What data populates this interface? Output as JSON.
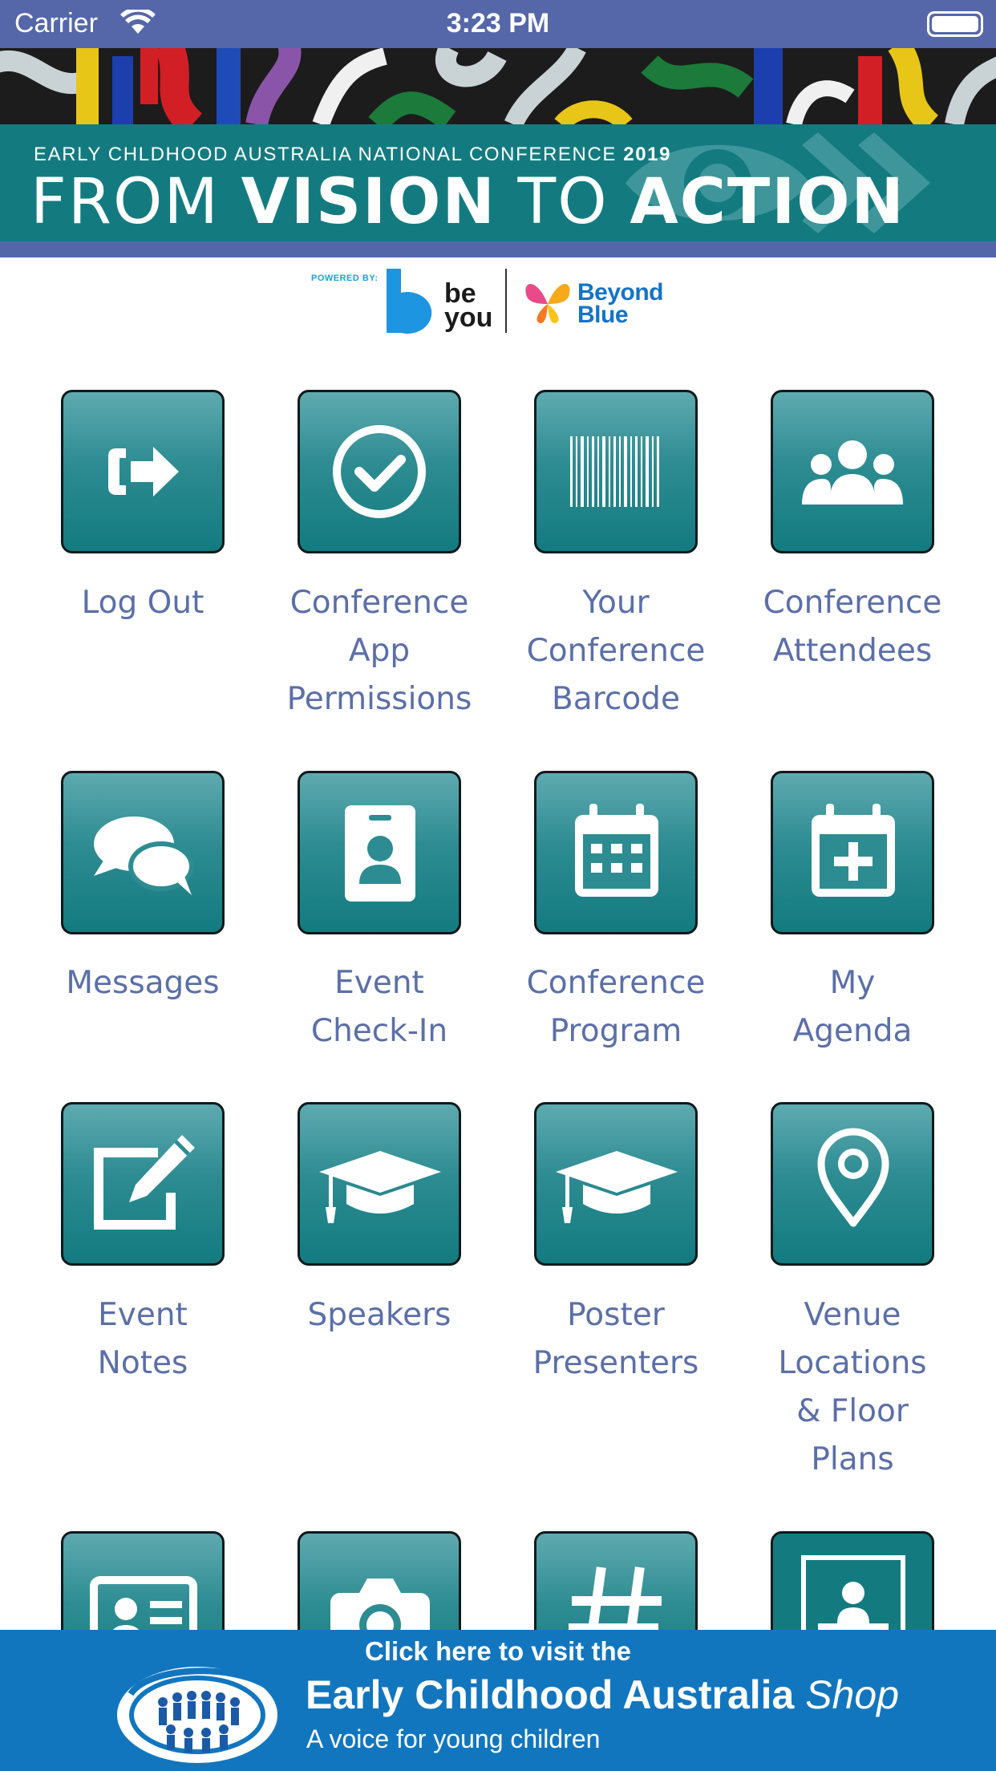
{
  "status_bar": {
    "carrier": "Carrier",
    "time": "3:23 PM",
    "icons": [
      "wifi-icon",
      "battery-icon"
    ]
  },
  "banner": {
    "subtitle_prefix": "EARLY CHLDHOOD AUSTRALIA NATIONAL CONFERENCE",
    "subtitle_year": "2019",
    "headline": {
      "part1": "FROM",
      "part2": "VISION",
      "part3": "TO",
      "part4": "ACTION"
    },
    "colors": {
      "teal": "#137b80",
      "stripe": "#5466aa"
    }
  },
  "sponsor": {
    "powered_by": "POWERED BY:",
    "beyou_line1": "be",
    "beyou_line2": "you",
    "beyondblue_line1": "Beyond",
    "beyondblue_line2": "Blue"
  },
  "menu": {
    "tiles": [
      {
        "icon": "logout-icon",
        "lines": [
          "Log Out"
        ]
      },
      {
        "icon": "check-circle-icon",
        "lines": [
          "Conference",
          "App",
          "Permissions"
        ]
      },
      {
        "icon": "barcode-icon",
        "lines": [
          "Your",
          "Conference",
          "Barcode"
        ]
      },
      {
        "icon": "users-icon",
        "lines": [
          "Conference",
          "Attendees"
        ]
      },
      {
        "icon": "chat-bubbles-icon",
        "lines": [
          "Messages"
        ]
      },
      {
        "icon": "id-badge-icon",
        "lines": [
          "Event",
          "Check-In"
        ]
      },
      {
        "icon": "calendar-icon",
        "lines": [
          "Conference",
          "Program"
        ]
      },
      {
        "icon": "calendar-plus-icon",
        "lines": [
          "My",
          "Agenda"
        ]
      },
      {
        "icon": "edit-note-icon",
        "lines": [
          "Event",
          "Notes"
        ]
      },
      {
        "icon": "graduation-cap-icon",
        "lines": [
          "Speakers"
        ]
      },
      {
        "icon": "graduation-cap-icon",
        "lines": [
          "Poster",
          "Presenters"
        ]
      },
      {
        "icon": "map-pin-icon",
        "lines": [
          "Venue",
          "Locations",
          "& Floor",
          "Plans"
        ]
      },
      {
        "icon": "contact-card-icon",
        "lines": []
      },
      {
        "icon": "camera-icon",
        "lines": []
      },
      {
        "icon": "hashtag-icon",
        "lines": []
      },
      {
        "icon": "exhibitor-booth-icon",
        "lines": []
      }
    ],
    "colors": {
      "tile": "#137b80",
      "label": "#5b6fa8"
    }
  },
  "footer": {
    "line1": "Click here to visit the",
    "line2": "Early Childhood Australia",
    "line2_shop": "Shop",
    "line3": "A voice for young children",
    "color": "#1276bf"
  }
}
